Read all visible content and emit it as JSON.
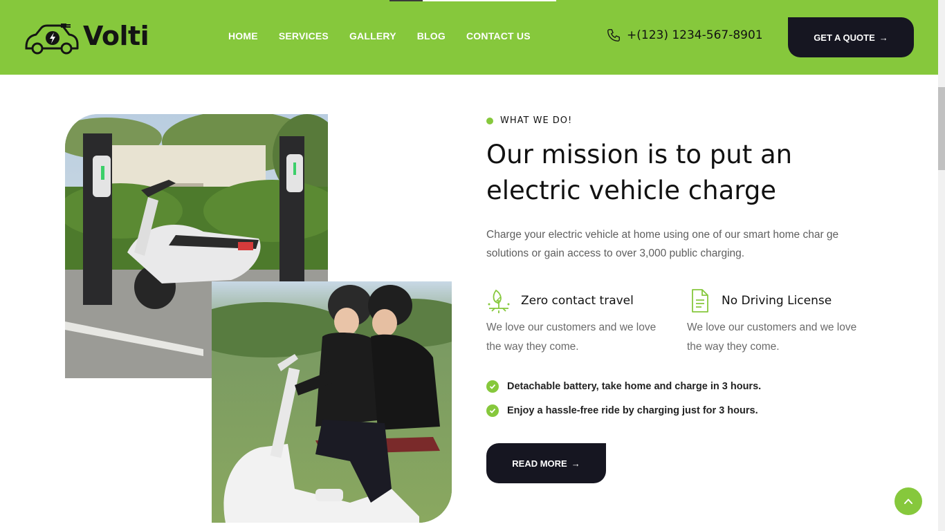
{
  "brand": {
    "name": "Volti",
    "accent": "#86c83c",
    "dark": "#161621"
  },
  "nav": {
    "items": [
      {
        "label": "HOME"
      },
      {
        "label": "SERVICES"
      },
      {
        "label": "GALLERY"
      },
      {
        "label": "BLOG"
      },
      {
        "label": "CONTACT US"
      }
    ]
  },
  "header": {
    "phone": "+(123) 1234-567-8901",
    "quote_label": "GET A QUOTE"
  },
  "about": {
    "eyebrow": "WHAT WE DO!",
    "title_line1": "Our mission is to put an",
    "title_line2": "electric vehicle charge",
    "description": "Charge your electric vehicle at home using one of our smart home char ge solutions or gain access to over 3,000 public charging.",
    "features": [
      {
        "title": "Zero contact travel",
        "text": "We love our customers and we love the way they come.",
        "icon": "plant-icon"
      },
      {
        "title": "No Driving License",
        "text": "We love our customers and we love the way they come.",
        "icon": "document-icon"
      }
    ],
    "checks": [
      "Detachable battery, take home and charge in 3 hours.",
      "Enjoy a hassle-free ride by charging just for 3 hours."
    ],
    "read_more_label": "READ MORE"
  },
  "icons": {
    "phone": "phone-icon",
    "arrow": "arrow-right-icon",
    "to_top": "chevron-up-icon",
    "check": "check-circle-icon"
  }
}
